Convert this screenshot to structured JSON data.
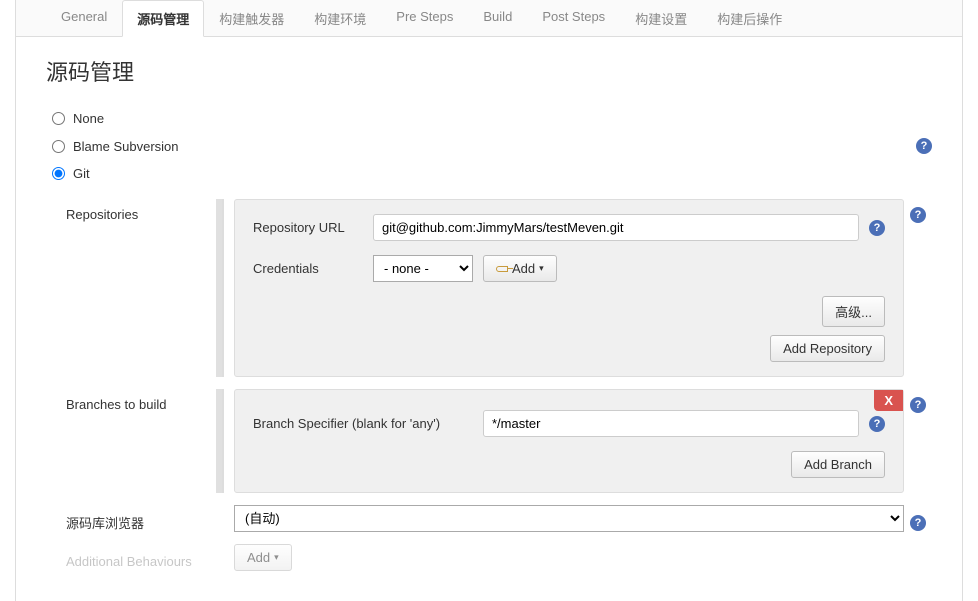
{
  "tabs": {
    "general": "General",
    "scm": "源码管理",
    "triggers": "构建触发器",
    "env": "构建环境",
    "pre_steps": "Pre Steps",
    "build": "Build",
    "post_steps": "Post Steps",
    "build_settings": "构建设置",
    "post_build": "构建后操作"
  },
  "section": {
    "title": "源码管理"
  },
  "scm_options": {
    "none": "None",
    "blame_svn": "Blame Subversion",
    "git": "Git"
  },
  "repositories": {
    "label": "Repositories",
    "url_label": "Repository URL",
    "url_value": "git@github.com:JimmyMars/testMeven.git",
    "credentials_label": "Credentials",
    "credentials_value": "- none -",
    "add_button": "Add",
    "advanced_button": "高级...",
    "add_repo_button": "Add Repository"
  },
  "branches": {
    "label": "Branches to build",
    "specifier_label": "Branch Specifier (blank for 'any')",
    "specifier_value": "*/master",
    "delete_label": "X",
    "add_branch_button": "Add Branch"
  },
  "repo_browser": {
    "label": "源码库浏览器",
    "value": "(自动)"
  },
  "additional": {
    "label": "Additional Behaviours",
    "add_button": "Add"
  }
}
